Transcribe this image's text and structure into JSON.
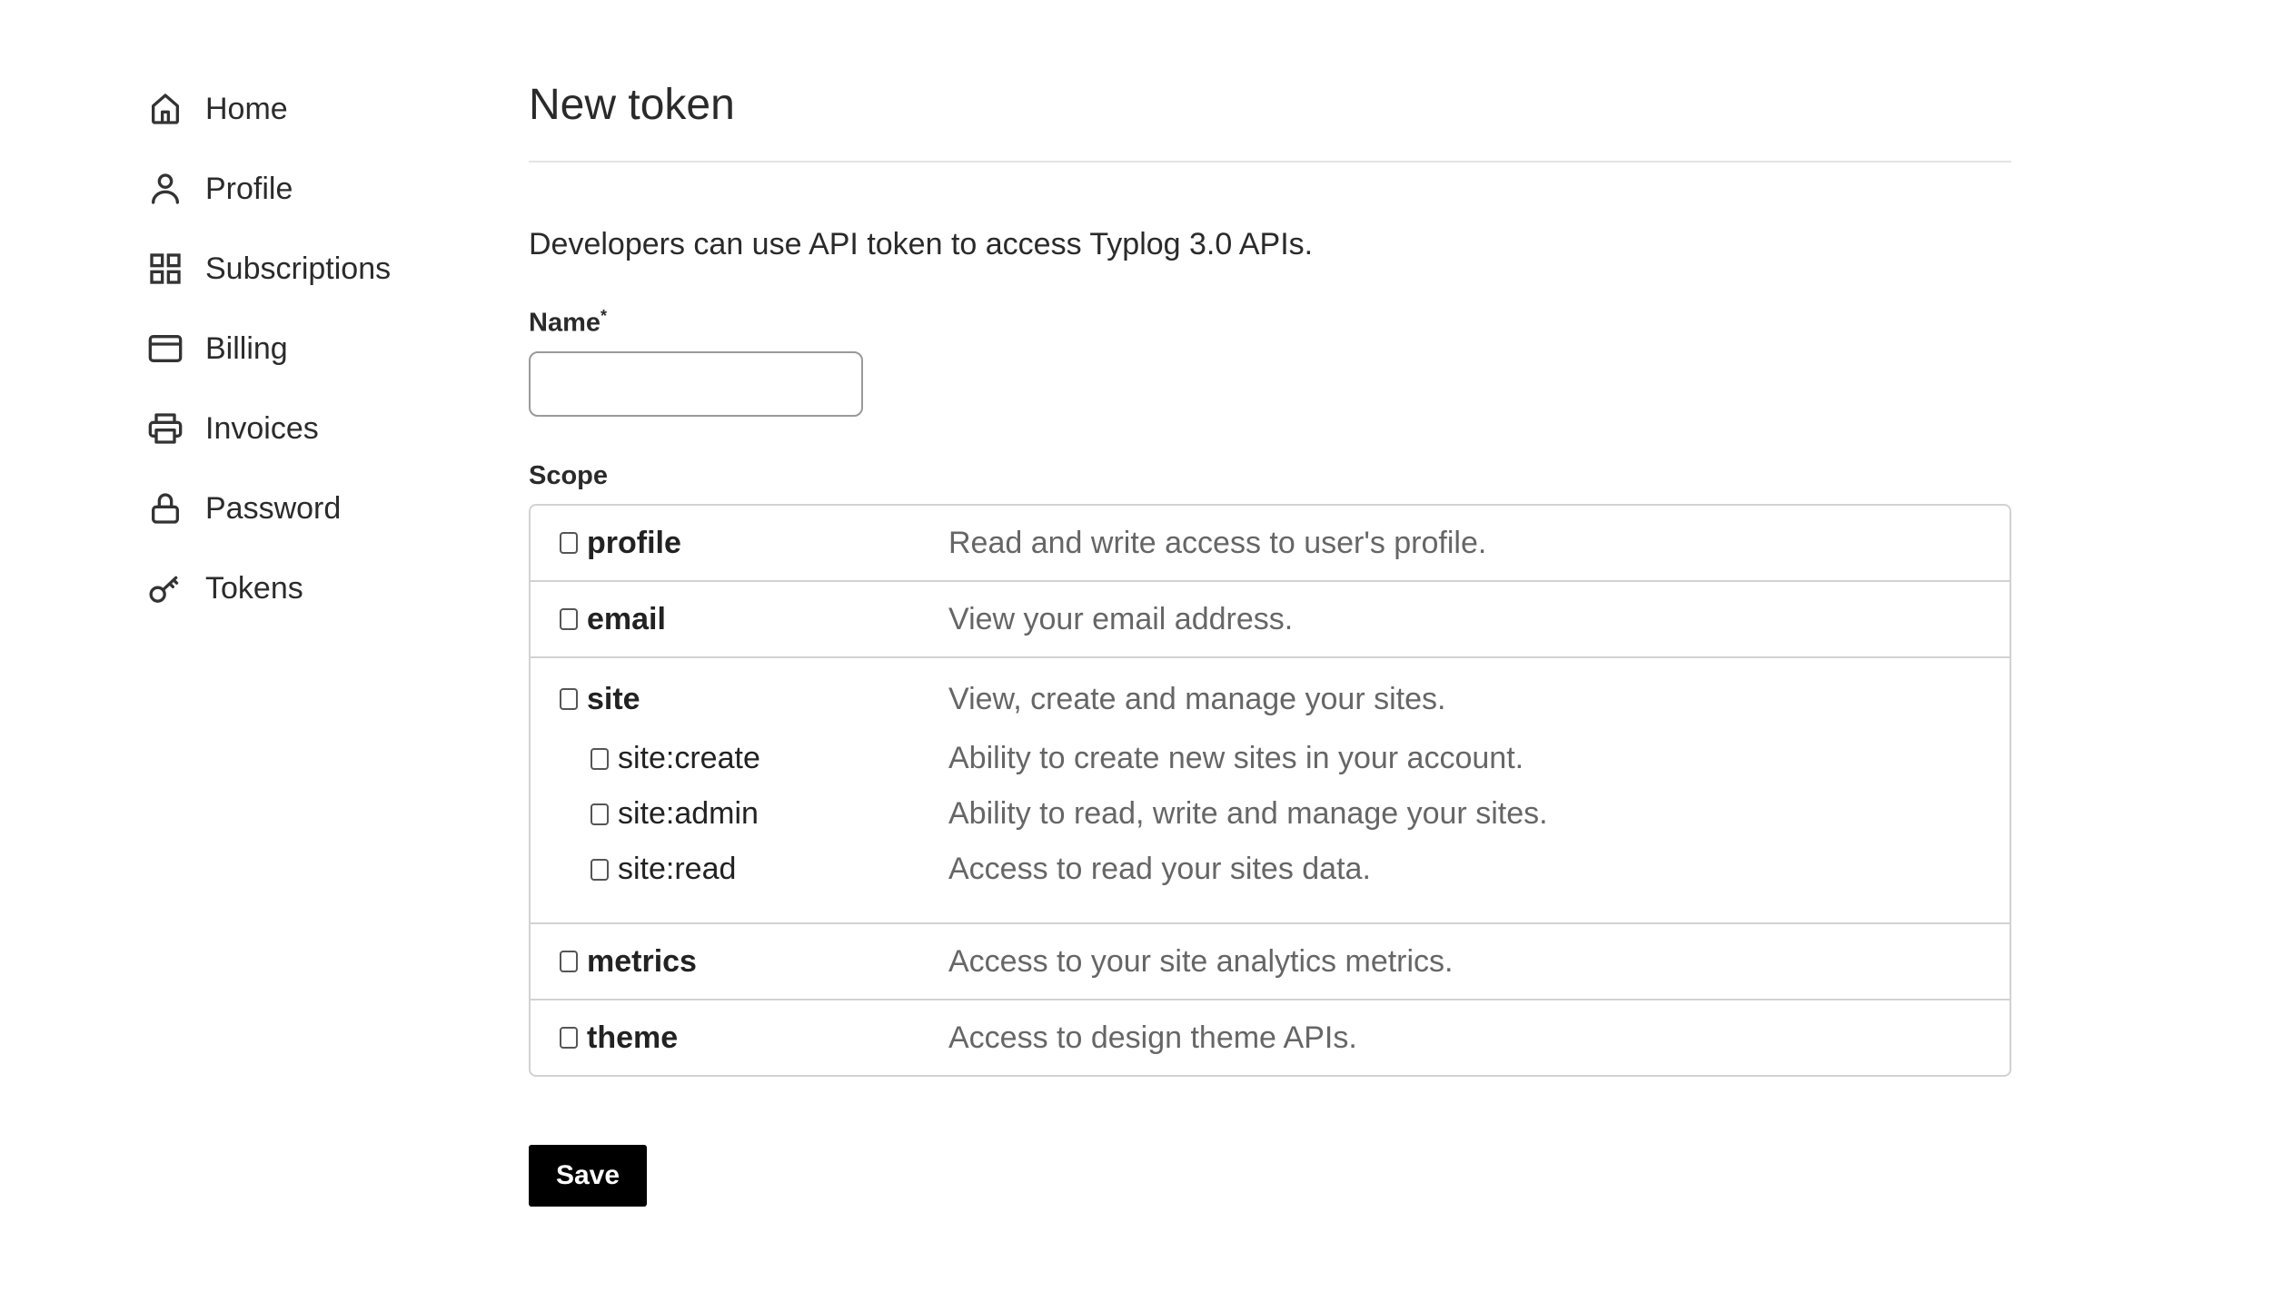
{
  "sidebar": {
    "items": [
      {
        "label": "Home",
        "icon": "home-icon"
      },
      {
        "label": "Profile",
        "icon": "user-icon"
      },
      {
        "label": "Subscriptions",
        "icon": "grid-icon"
      },
      {
        "label": "Billing",
        "icon": "credit-card-icon"
      },
      {
        "label": "Invoices",
        "icon": "printer-icon"
      },
      {
        "label": "Password",
        "icon": "lock-icon"
      },
      {
        "label": "Tokens",
        "icon": "key-icon"
      }
    ]
  },
  "page": {
    "title": "New token",
    "description": "Developers can use API token to access Typlog 3.0 APIs.",
    "name_label": "Name",
    "name_required_mark": "*",
    "name_value": "",
    "scope_label": "Scope",
    "save_label": "Save"
  },
  "scopes": [
    {
      "name": "profile",
      "description": "Read and write access to user's profile.",
      "checked": false
    },
    {
      "name": "email",
      "description": "View your email address.",
      "checked": false
    },
    {
      "name": "site",
      "description": "View, create and manage your sites.",
      "checked": false,
      "children": [
        {
          "name": "site:create",
          "description": "Ability to create new sites in your account.",
          "checked": false
        },
        {
          "name": "site:admin",
          "description": "Ability to read, write and manage your sites.",
          "checked": false
        },
        {
          "name": "site:read",
          "description": "Access to read your sites data.",
          "checked": false
        }
      ]
    },
    {
      "name": "metrics",
      "description": "Access to your site analytics metrics.",
      "checked": false
    },
    {
      "name": "theme",
      "description": "Access to design theme APIs.",
      "checked": false
    }
  ]
}
